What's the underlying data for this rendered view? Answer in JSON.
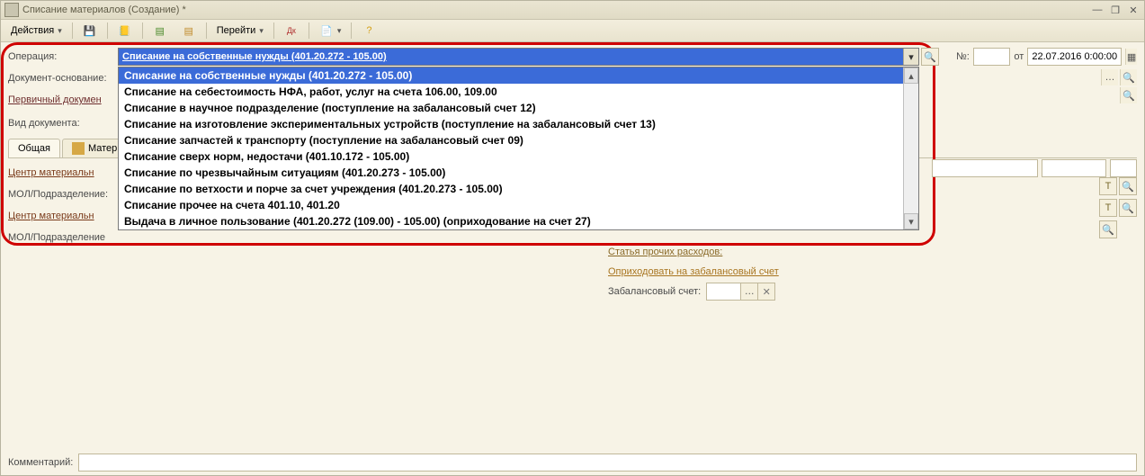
{
  "window": {
    "title": "Списание материалов (Создание) *"
  },
  "toolbar": {
    "actions_label": "Действия",
    "goto_label": "Перейти"
  },
  "labels": {
    "operation": "Операция:",
    "basis_doc": "Документ-основание:",
    "primary_doc": "Первичный докумен",
    "doc_type": "Вид документа:",
    "center1": "Центр материальн",
    "mol1": "МОЛ/Подразделение:",
    "center2": "Центр материальн",
    "mol2": "МОЛ/Подразделение",
    "number": "№:",
    "from": "от",
    "other_exp": "Статья прочих расходов:",
    "off_balance_head": "Оприходовать на забалансовый счет",
    "off_balance_acct": "Забалансовый счет:",
    "comment": "Комментарий:"
  },
  "operation": {
    "selected": "Списание на собственные нужды (401.20.272 - 105.00)",
    "options": [
      "Списание на собственные нужды (401.20.272 - 105.00)",
      "Списание на себестоимость НФА, работ, услуг на счета 106.00, 109.00",
      "Списание в научное подразделение (поступление на забалансовый счет 12)",
      "Списание на изготовление экспериментальных устройств (поступление на забалансовый счет 13)",
      "Списание запчастей к транспорту (поступление на забалансовый счет 09)",
      "Списание сверх норм, недостачи (401.10.172 - 105.00)",
      "Списание по чрезвычайным ситуациям (401.20.273 - 105.00)",
      "Списание по ветхости и порче за счет учреждения (401.20.273 - 105.00)",
      "Списание прочее на счета 401.10, 401.20",
      "Выдача в личное пользование (401.20.272 (109.00) - 105.00) (оприходование на счет 27)"
    ]
  },
  "tabs": {
    "general": "Общая",
    "materials": "Матер"
  },
  "doc": {
    "number": "",
    "date": "22.07.2016 0:00:00"
  }
}
